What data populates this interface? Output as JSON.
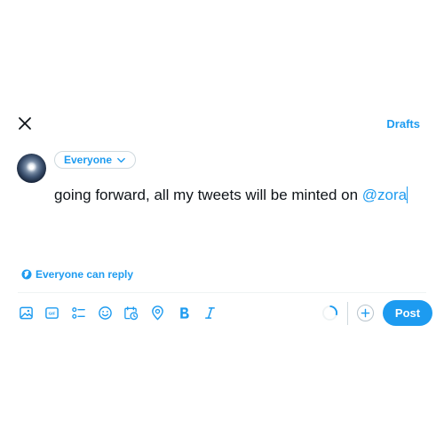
{
  "header": {
    "drafts_label": "Drafts",
    "close_icon": "close-icon"
  },
  "composer": {
    "audience_label": "Everyone",
    "text_before": "going forward, all my tweets will be minted on ",
    "mention": "@zora"
  },
  "reply_setting": {
    "label": "Everyone can reply",
    "icon": "globe-icon"
  },
  "toolbar": {
    "icons": [
      "image-icon",
      "gif-icon",
      "poll-icon",
      "emoji-icon",
      "schedule-icon",
      "location-icon",
      "bold-icon",
      "italic-icon"
    ],
    "post_label": "Post",
    "accent_color": "#1d9bf0"
  }
}
